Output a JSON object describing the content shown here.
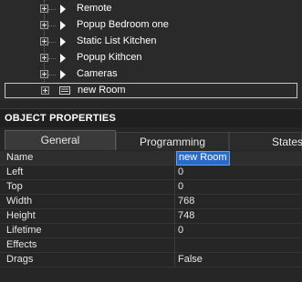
{
  "tree": {
    "items": [
      {
        "label": "Remote",
        "icon": "chevron-right-icon"
      },
      {
        "label": "Popup Bedroom one",
        "icon": "chevron-right-icon"
      },
      {
        "label": "Static List Kitchen",
        "icon": "chevron-right-icon"
      },
      {
        "label": "Popup Kithcen",
        "icon": "chevron-right-icon"
      },
      {
        "label": "Cameras",
        "icon": "chevron-right-icon"
      }
    ],
    "selected": {
      "label": "new Room",
      "icon": "room-list-icon"
    }
  },
  "panel": {
    "title": "OBJECT PROPERTIES",
    "tabs": [
      {
        "label": "General",
        "active": true
      },
      {
        "label": "Programming",
        "active": false
      },
      {
        "label": "States",
        "active": false
      }
    ],
    "properties": [
      {
        "name": "Name",
        "value": "new Room"
      },
      {
        "name": "Left",
        "value": "0"
      },
      {
        "name": "Top",
        "value": "0"
      },
      {
        "name": "Width",
        "value": "768"
      },
      {
        "name": "Height",
        "value": "748"
      },
      {
        "name": "Lifetime",
        "value": "0"
      },
      {
        "name": "Effects",
        "value": ""
      },
      {
        "name": "Drags",
        "value": "False"
      }
    ]
  },
  "colors": {
    "background": "#262626",
    "selection": "#2a6ac8",
    "text": "#e8e8e8"
  }
}
